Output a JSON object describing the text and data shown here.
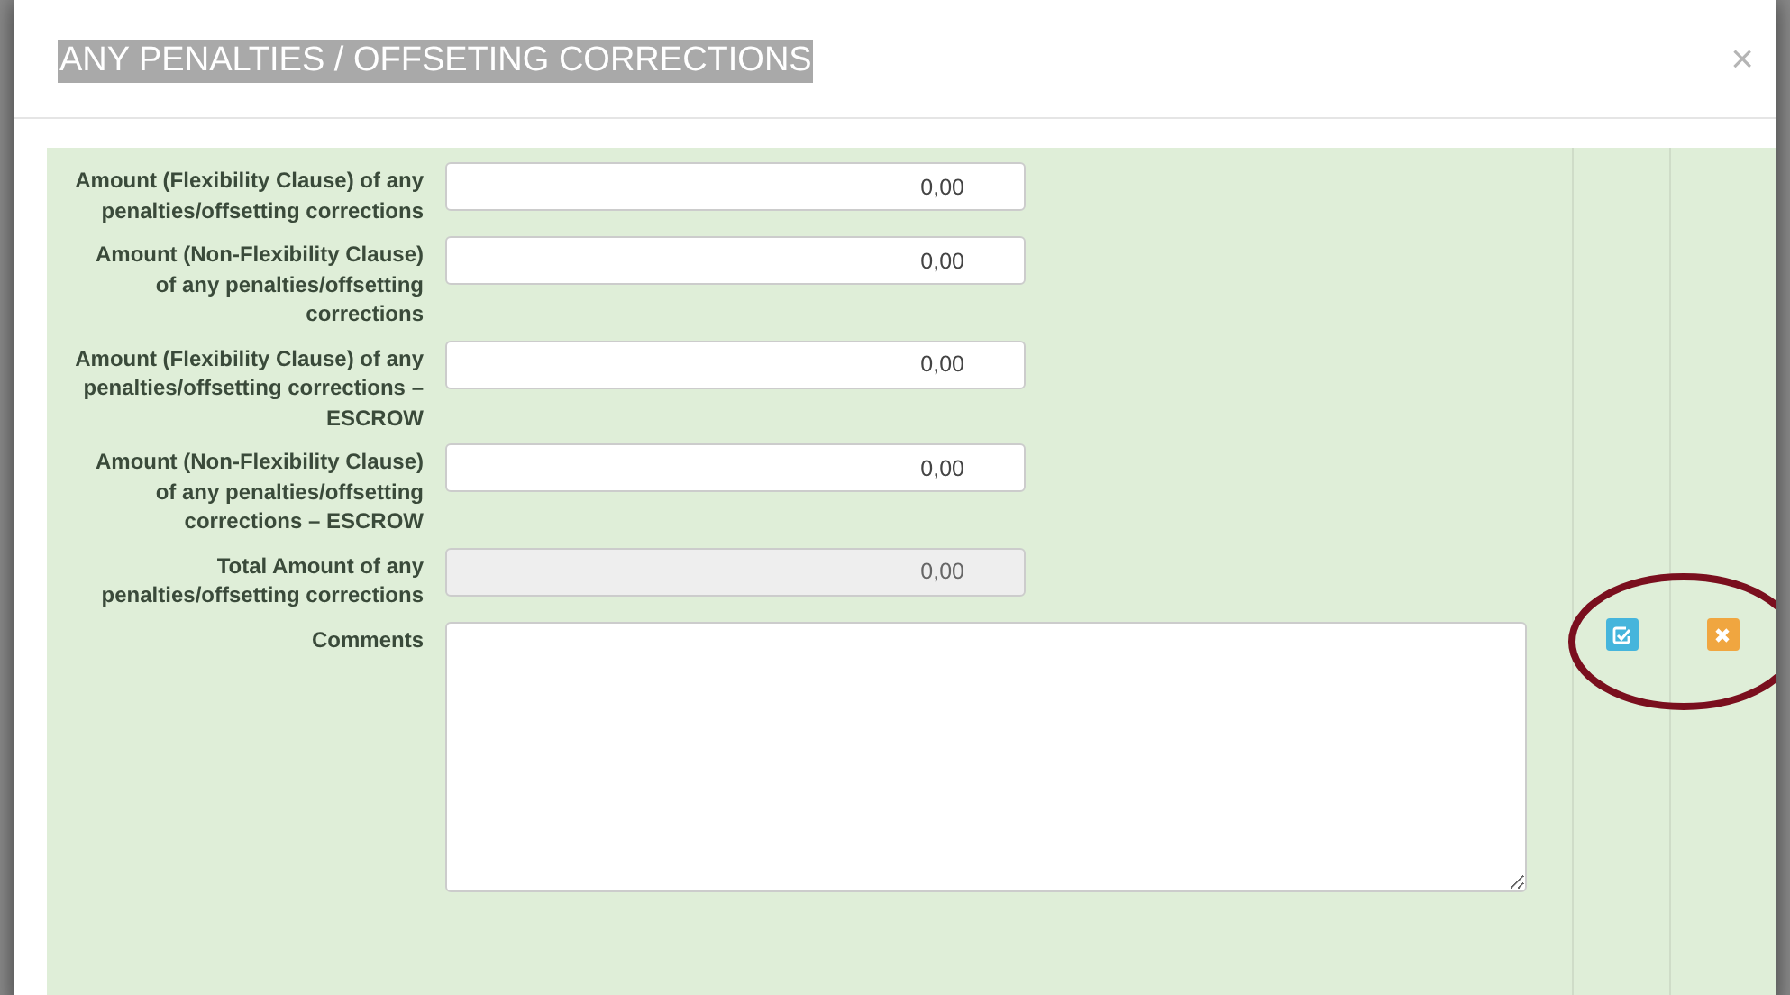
{
  "modal": {
    "title": "ANY PENALTIES / OFFSETING CORRECTIONS",
    "title_highlighted": true,
    "close": "×"
  },
  "fields": [
    {
      "kind": "input",
      "label": "Amount (Flexibility Clause) of any penalties/offsetting corrections",
      "value": "0,00",
      "disabled": false
    },
    {
      "kind": "input",
      "label": "Amount (Non-Flexibility Clause) of any penalties/offsetting corrections",
      "value": "0,00",
      "disabled": false
    },
    {
      "kind": "input",
      "label": "Amount (Flexibility Clause) of any penalties/offsetting corrections – ESCROW",
      "value": "0,00",
      "disabled": false
    },
    {
      "kind": "input",
      "label": "Amount (Non-Flexibility Clause) of any penalties/offsetting corrections – ESCROW",
      "value": "0,00",
      "disabled": false
    },
    {
      "kind": "input",
      "label": "Total Amount of any penalties/offsetting corrections",
      "value": "0,00",
      "disabled": true
    },
    {
      "kind": "textarea",
      "label": "Comments",
      "disabled": false
    }
  ],
  "actions": [
    {
      "kind": "edit"
    },
    {
      "kind": "cancel"
    }
  ],
  "annotation_ring": true
}
